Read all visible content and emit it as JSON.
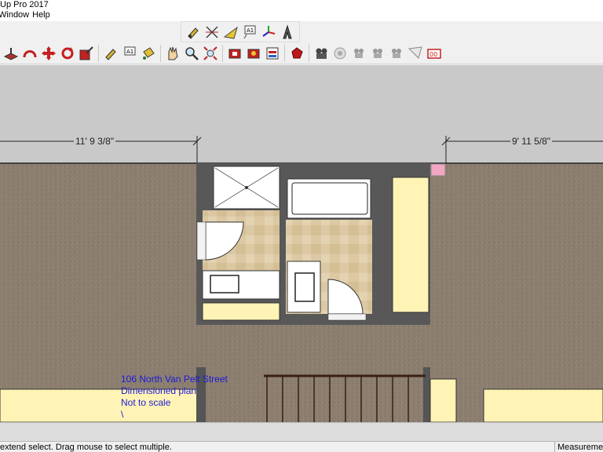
{
  "window": {
    "title": "Up Pro 2017"
  },
  "menu": [
    {
      "label": "Window"
    },
    {
      "label": "Help"
    }
  ],
  "toolbar_top": {
    "icons": [
      "tape-measure-icon",
      "dimension-icon",
      "protractor-icon",
      "text-icon",
      "axes-icon",
      "3d-text-icon"
    ]
  },
  "toolbar_main": {
    "icons": [
      "push-pull-icon",
      "follow-me-icon",
      "move-icon",
      "rotate-icon",
      "scale-icon",
      "tape-measure-icon",
      "text-icon",
      "paint-bucket-icon",
      "pan-icon",
      "zoom-icon",
      "zoom-extents-icon",
      "3d-warehouse-icon",
      "extension-warehouse-icon",
      "layout-icon",
      "ruby-icon",
      "advanced-camera-icon",
      "look-around-icon",
      "camera-1-icon",
      "camera-2-icon",
      "camera-3-icon",
      "camera-frustum-icon",
      "camera-clear-icon"
    ]
  },
  "dimensions": {
    "left": "11' 9 3/8\"",
    "right": "9' 11 5/8\""
  },
  "annotation": {
    "line1": "106 North Van Pelt Street",
    "line2": "Dimensioned plan",
    "line3": "Not to scale",
    "line4": "\\"
  },
  "status": {
    "message": "extend select. Drag mouse to select multiple.",
    "measurements_label": "Measurements"
  },
  "colors": {
    "carpet": "#8b7d6d",
    "wall": "#555555",
    "tile": "#d9c7a0",
    "cabinet": "#fff3b5",
    "annotation": "#1b1bd8"
  }
}
